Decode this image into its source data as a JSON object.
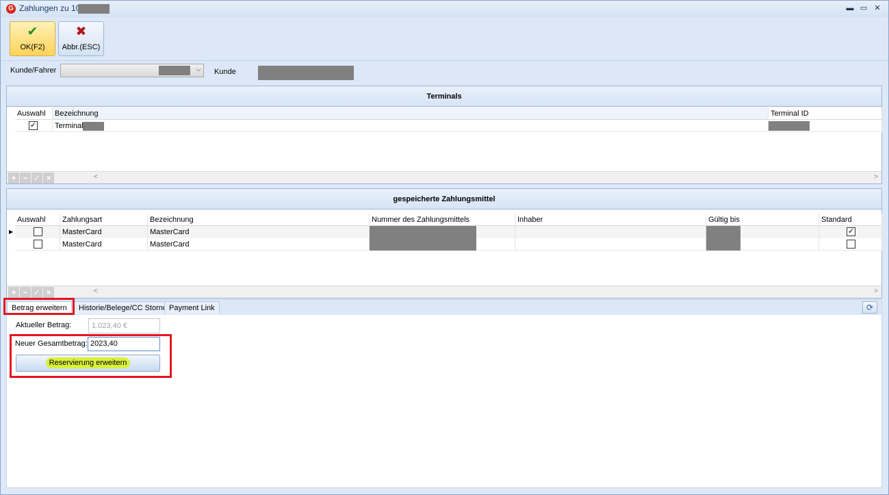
{
  "window": {
    "title": "Zahlungen zu 10",
    "app_icon": "G",
    "controls": {
      "minimize": "▬",
      "maximize": "▭",
      "close": "✕"
    }
  },
  "toolbar": {
    "ok_label": "OK(F2)",
    "ok_icon": "✔",
    "cancel_label": "Abbr.(ESC)",
    "cancel_icon": "✖"
  },
  "filter": {
    "driver_label": "Kunde/Fahrer",
    "customer_label": "Kunde",
    "combo_arrow": "⌵"
  },
  "terminals": {
    "title": "Terminals",
    "columns": [
      "Auswahl",
      "Bezeichnung",
      "Terminal ID"
    ],
    "rows": [
      {
        "selected": "✓",
        "name": "Terminal"
      }
    ]
  },
  "payment_methods": {
    "title": "gespeicherte Zahlungsmittel",
    "columns": [
      "Auswahl",
      "Zahlungsart",
      "Bezeichnung",
      "Nummer des Zahlungsmittels",
      "Inhaber",
      "Gültig bis",
      "Standard"
    ],
    "rows": [
      {
        "indicator": "▶",
        "type": "MasterCard",
        "name": "MasterCard",
        "standard": "✓"
      },
      {
        "indicator": "",
        "type": "MasterCard",
        "name": "MasterCard",
        "standard": ""
      }
    ]
  },
  "navigator": {
    "add": "+",
    "remove": "−",
    "confirm": "✓",
    "cancel": "×",
    "scroll_left": "<",
    "scroll_right": ">"
  },
  "tabs": [
    {
      "label": "Betrag erweitern"
    },
    {
      "label": "Historie/Belege/CC Storno"
    },
    {
      "label": "Payment Link"
    }
  ],
  "refresh_icon": "⟳",
  "amount_form": {
    "current_label": "Aktueller Betrag:",
    "current_value": "1.023,40 €",
    "new_label": "Neuer Gesamtbetrag:",
    "new_value": "2023,40",
    "extend_button": "Reservierung erweitern"
  },
  "colors": {
    "annotation": "#e3141f",
    "highlight": "#d9f03c",
    "ok_button": "#fcd35a"
  }
}
